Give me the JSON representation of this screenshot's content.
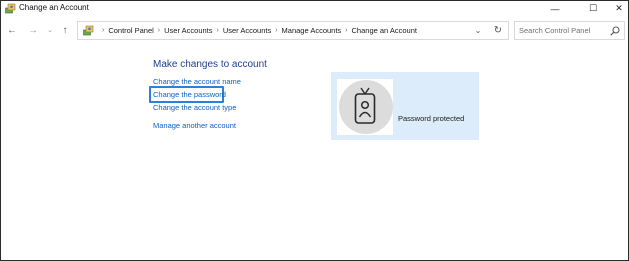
{
  "window": {
    "title": "Change an Account",
    "minimize_glyph": "—",
    "maximize_glyph": "☐",
    "close_glyph": "✕"
  },
  "nav": {
    "back_glyph": "←",
    "forward_glyph": "→",
    "recent_glyph": "⌄",
    "up_glyph": "↑"
  },
  "address": {
    "breadcrumbs": [
      "Control Panel",
      "User Accounts",
      "User Accounts",
      "Manage Accounts",
      "Change an Account"
    ],
    "separator": "›",
    "dropdown_glyph": "⌄",
    "refresh_glyph": "↻"
  },
  "search": {
    "placeholder": "Search Control Panel"
  },
  "content": {
    "heading": "Make changes to account",
    "links": {
      "change_name": "Change the account name",
      "change_password": "Change the password",
      "change_type": "Change the account type",
      "manage_another": "Manage another account"
    }
  },
  "account": {
    "status": "Password protected"
  },
  "icons": {
    "title": "control-panel-icon",
    "address": "control-panel-icon",
    "search": "search-icon",
    "avatar": "user-badge-icon"
  },
  "colors": {
    "link": "#0f5fc4",
    "heading": "#1e3f8f",
    "focus": "#2f7fd8",
    "panel": "#dcecfb"
  }
}
